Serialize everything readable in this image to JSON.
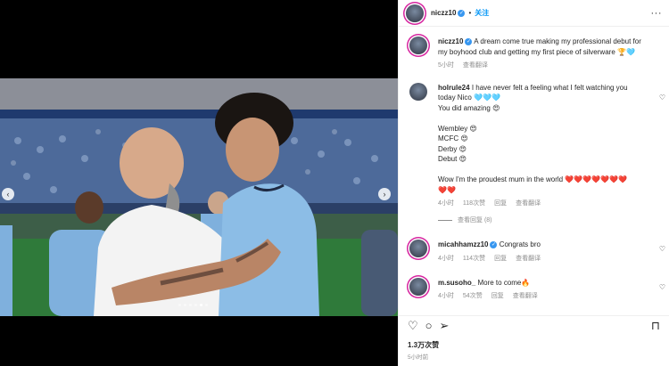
{
  "post": {
    "author": "niczz10",
    "follow_label": "关注",
    "more_icon": "ellipsis-icon",
    "media_dots": 6,
    "media_active_dot": 5
  },
  "caption": {
    "username": "niczz10",
    "text_lines": [
      "A dream come true making my professional debut for",
      "my boyhood club and getting my first piece of silverware 🏆🩵"
    ],
    "time": "5小时",
    "translate": "查看翻译"
  },
  "comments": [
    {
      "username": "holrule24",
      "lines": [
        "I have never felt a feeling what I felt watching you",
        "today Nico 🩵🩵🩵",
        "You did amazing 😍",
        "",
        "Wembley 😍",
        "MCFC 😍",
        "Derby 😍",
        "Debut 😍",
        "",
        "Wow I'm the proudest mum in the world ❤️❤️❤️❤️❤️❤️❤️",
        "❤️❤️"
      ],
      "time": "4小时",
      "likes": "118次赞",
      "reply": "回复",
      "translate": "查看翻译",
      "view_replies": "查看回复 (8)"
    },
    {
      "username": "micahhamzz10",
      "text": "Congrats bro",
      "time": "4小时",
      "likes": "114次赞",
      "reply": "回复",
      "translate": "查看翻译"
    },
    {
      "username": "m.susoho_",
      "text": "More to come🔥",
      "time": "4小时",
      "likes": "54次赞",
      "reply": "回复",
      "translate": "查看翻译"
    }
  ],
  "footer": {
    "likes": "1.3万次赞",
    "timestamp": "5小时前"
  },
  "colors": {
    "follow": "#0095f6",
    "verified": "#3897f0",
    "heart": "#e0245e"
  }
}
